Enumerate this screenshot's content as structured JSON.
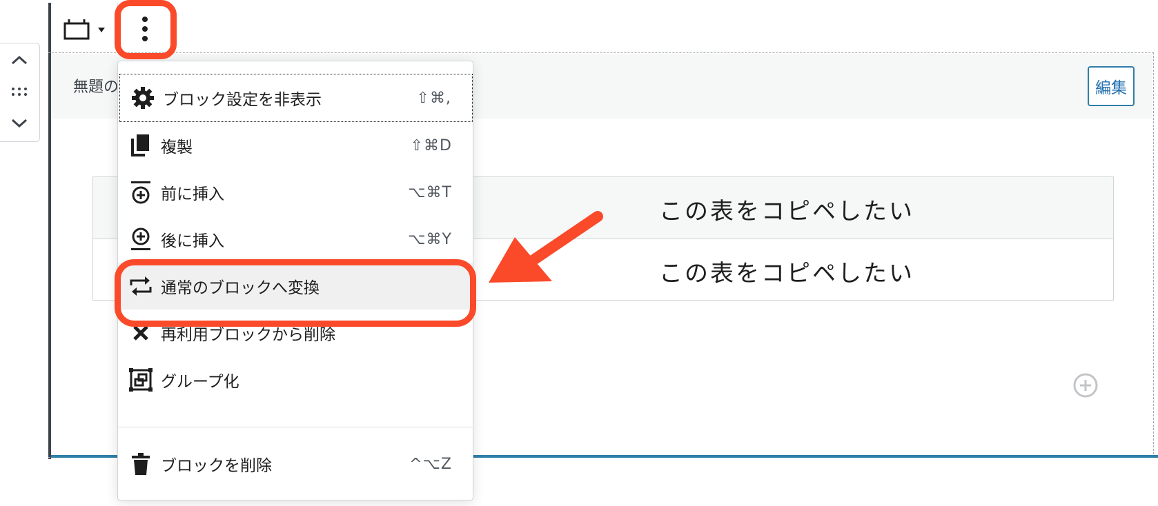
{
  "block": {
    "title": "無題の",
    "edit_label": "編集"
  },
  "table": {
    "rows": [
      {
        "text": "この表をコピペしたい"
      },
      {
        "text": "この表をコピペしたい"
      }
    ]
  },
  "menu": {
    "items": [
      {
        "label": "ブロック設定を非表示",
        "shortcut": "⇧⌘,"
      },
      {
        "label": "複製",
        "shortcut": "⇧⌘D"
      },
      {
        "label": "前に挿入",
        "shortcut": "⌥⌘T"
      },
      {
        "label": "後に挿入",
        "shortcut": "⌥⌘Y"
      },
      {
        "label": "通常のブロックへ変換",
        "shortcut": ""
      },
      {
        "label": "再利用ブロックから削除",
        "shortcut": ""
      },
      {
        "label": "グループ化",
        "shortcut": ""
      },
      {
        "label": "ブロックを削除",
        "shortcut": "^⌥Z"
      }
    ]
  },
  "icons": {
    "toolbar_block": "reusable-block-icon",
    "toolbar_options": "more-vertical-icon",
    "mover_up": "chevron-up-icon",
    "mover_drag": "drag-handle-icon",
    "mover_down": "chevron-down-icon",
    "add_block": "plus-circle-icon"
  },
  "colors": {
    "highlight": "#fa4a2a",
    "accent": "#2271b1"
  }
}
